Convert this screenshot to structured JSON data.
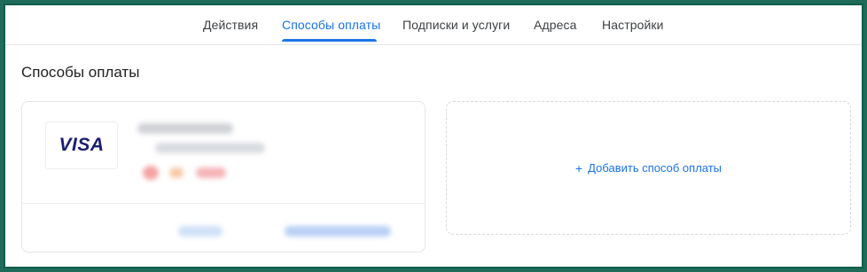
{
  "tabs": [
    {
      "label": "Действия"
    },
    {
      "label": "Способы оплаты",
      "active": true
    },
    {
      "label": "Подписки и услуги"
    },
    {
      "label": "Адреса"
    },
    {
      "label": "Настройки"
    }
  ],
  "page_title": "Способы оплаты",
  "payment_card": {
    "brand": "VISA",
    "brand_color": "#1a1f71"
  },
  "add_payment": {
    "icon": "plus-icon",
    "plus": "+",
    "label": "Добавить способ оплаты"
  },
  "colors": {
    "accent": "#1a73e8",
    "frame": "#0f5d4a"
  }
}
